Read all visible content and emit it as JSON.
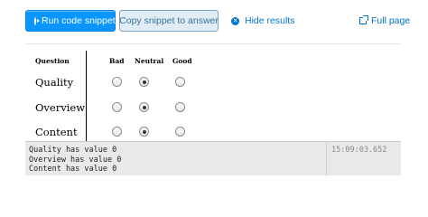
{
  "toolbar": {
    "run_label": "Run code snippet",
    "copy_label": "Copy snippet to answer",
    "hide_label": "Hide results",
    "full_label": "Full page",
    "run_icon": "play-circle-icon",
    "hide_icon": "close-circle-icon",
    "full_icon": "external-link-icon"
  },
  "table": {
    "header_question": "Question",
    "columns": [
      "Bad",
      "Neutral",
      "Good"
    ],
    "rows": [
      {
        "label": "Quality",
        "selected": "Neutral"
      },
      {
        "label": "Overview",
        "selected": "Neutral"
      },
      {
        "label": "Content",
        "selected": "Neutral"
      }
    ]
  },
  "console": {
    "lines": [
      "Quality has value 0",
      "Overview has value 0",
      "Content has value 0"
    ],
    "timestamp": "15:09:03.652"
  },
  "colors": {
    "accent": "#0a95ff",
    "link": "#0074cc",
    "secondary_bg": "#e1ecf4",
    "console_bg": "#e9e9e9"
  }
}
